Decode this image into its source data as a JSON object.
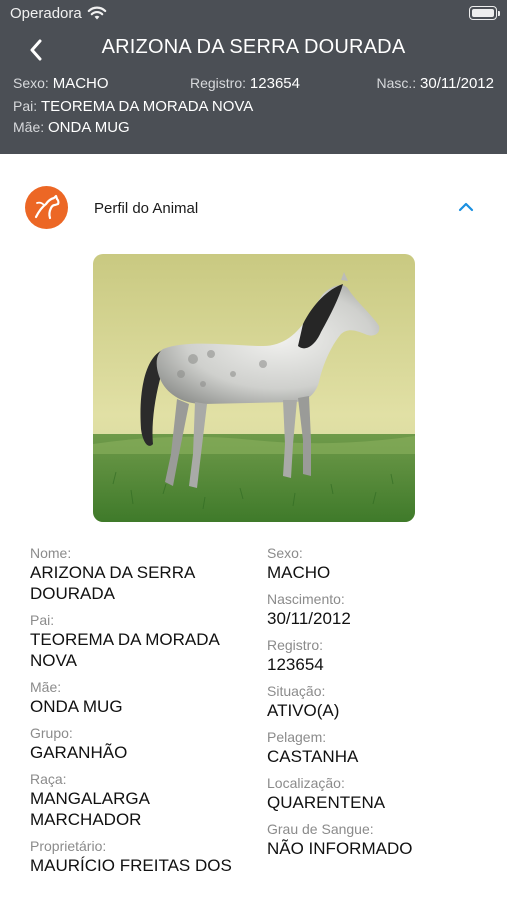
{
  "status_bar": {
    "carrier": "Operadora"
  },
  "header": {
    "title": "ARIZONA DA SERRA DOURADA",
    "sexo_label": "Sexo:",
    "sexo_value": "MACHO",
    "registro_label": "Registro:",
    "registro_value": "123654",
    "nasc_label": "Nasc.:",
    "nasc_value": "30/11/2012",
    "pai_label": "Pai:",
    "pai_value": "TEOREMA DA MORADA NOVA",
    "mae_label": "Mãe:",
    "mae_value": "ONDA MUG"
  },
  "section": {
    "title": "Perfil do Animal",
    "icon": "horse-head-icon",
    "accent": "#ec6725",
    "chevron_color": "#1a8fe0"
  },
  "fields_left": [
    {
      "label": "Nome:",
      "value": "ARIZONA DA SERRA DOURADA"
    },
    {
      "label": "Pai:",
      "value": "TEOREMA DA MORADA NOVA"
    },
    {
      "label": "Mãe:",
      "value": "ONDA MUG"
    },
    {
      "label": "Grupo:",
      "value": "GARANHÃO"
    },
    {
      "label": "Raça:",
      "value": "MANGALARGA MARCHADOR"
    },
    {
      "label": "Proprietário:",
      "value": "MAURÍCIO FREITAS DOS"
    }
  ],
  "fields_right": [
    {
      "label": "Sexo:",
      "value": "MACHO"
    },
    {
      "label": "Nascimento:",
      "value": "30/11/2012"
    },
    {
      "label": "Registro:",
      "value": "123654"
    },
    {
      "label": "Situação:",
      "value": "ATIVO(A)"
    },
    {
      "label": "Pelagem:",
      "value": "CASTANHA"
    },
    {
      "label": "Localização:",
      "value": "QUARENTENA"
    },
    {
      "label": "Grau de Sangue:",
      "value": "NÃO INFORMADO"
    }
  ]
}
